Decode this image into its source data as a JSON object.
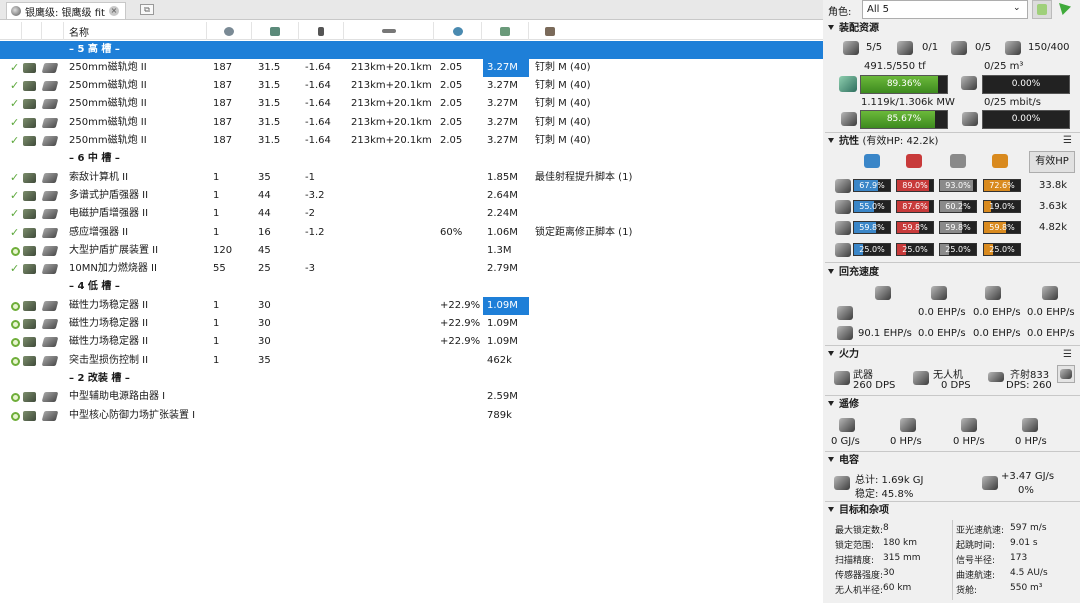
{
  "tab": {
    "title": "银鹰级: 银鹰级 fit",
    "close": "×",
    "new": "⧉"
  },
  "columns": {
    "name": "名称"
  },
  "colors": {
    "rack_bg": "#1e7fd8",
    "em": "#3a86c8",
    "thermal": "#c83a3a",
    "kinetic": "#8a8a8a",
    "explosive": "#d98a1e",
    "cap_green": "#5aa82e"
  },
  "rows": [
    {
      "kind": "rack",
      "label": "– 5 高 槽 –"
    },
    {
      "kind": "mod",
      "state": "on",
      "name": "250mm磁轨炮 II",
      "c1": "187",
      "c2": "31.5",
      "c3": "-1.64",
      "c4": "213km+20.1km",
      "c5": "2.05",
      "c6": "",
      "price": "3.27M",
      "charge": "钉刺 M (40)",
      "hl": true
    },
    {
      "kind": "mod",
      "state": "on",
      "name": "250mm磁轨炮 II",
      "c1": "187",
      "c2": "31.5",
      "c3": "-1.64",
      "c4": "213km+20.1km",
      "c5": "2.05",
      "c6": "",
      "price": "3.27M",
      "charge": "钉刺 M (40)"
    },
    {
      "kind": "mod",
      "state": "on",
      "name": "250mm磁轨炮 II",
      "c1": "187",
      "c2": "31.5",
      "c3": "-1.64",
      "c4": "213km+20.1km",
      "c5": "2.05",
      "c6": "",
      "price": "3.27M",
      "charge": "钉刺 M (40)"
    },
    {
      "kind": "mod",
      "state": "on",
      "name": "250mm磁轨炮 II",
      "c1": "187",
      "c2": "31.5",
      "c3": "-1.64",
      "c4": "213km+20.1km",
      "c5": "2.05",
      "c6": "",
      "price": "3.27M",
      "charge": "钉刺 M (40)"
    },
    {
      "kind": "mod",
      "state": "on",
      "name": "250mm磁轨炮 II",
      "c1": "187",
      "c2": "31.5",
      "c3": "-1.64",
      "c4": "213km+20.1km",
      "c5": "2.05",
      "c6": "",
      "price": "3.27M",
      "charge": "钉刺 M (40)"
    },
    {
      "kind": "sub",
      "label": "– 6 中 槽 –"
    },
    {
      "kind": "mod",
      "state": "on",
      "name": "索敌计算机 II",
      "c1": "1",
      "c2": "35",
      "c3": "-1",
      "c4": "",
      "c5": "",
      "c6": "",
      "price": "1.85M",
      "charge": "最佳射程提升脚本 (1)"
    },
    {
      "kind": "mod",
      "state": "on",
      "name": "多谱式护盾强器 II",
      "c1": "1",
      "c2": "44",
      "c3": "-3.2",
      "c4": "",
      "c5": "",
      "c6": "",
      "price": "2.64M",
      "charge": ""
    },
    {
      "kind": "mod",
      "state": "on",
      "name": "电磁护盾增强器 II",
      "c1": "1",
      "c2": "44",
      "c3": "-2",
      "c4": "",
      "c5": "",
      "c6": "",
      "price": "2.24M",
      "charge": ""
    },
    {
      "kind": "mod",
      "state": "on",
      "name": "感应增强器 II",
      "c1": "1",
      "c2": "16",
      "c3": "-1.2",
      "c4": "",
      "c5": "",
      "c6": "60%",
      "price": "1.06M",
      "charge": "锁定距离修正脚本 (1)"
    },
    {
      "kind": "mod",
      "state": "off",
      "name": "大型护盾扩展装置 II",
      "c1": "120",
      "c2": "45",
      "c3": "",
      "c4": "",
      "c5": "",
      "c6": "",
      "price": "1.3M",
      "charge": ""
    },
    {
      "kind": "mod",
      "state": "on",
      "name": "10MN加力燃烧器 II",
      "c1": "55",
      "c2": "25",
      "c3": "-3",
      "c4": "",
      "c5": "",
      "c6": "",
      "price": "2.79M",
      "charge": ""
    },
    {
      "kind": "sub",
      "label": "– 4 低 槽 –"
    },
    {
      "kind": "mod",
      "state": "off",
      "name": "磁性力场稳定器 II",
      "c1": "1",
      "c2": "30",
      "c3": "",
      "c4": "",
      "c5": "",
      "c6": "+22.9%",
      "price": "1.09M",
      "charge": "",
      "hl": true
    },
    {
      "kind": "mod",
      "state": "off",
      "name": "磁性力场稳定器 II",
      "c1": "1",
      "c2": "30",
      "c3": "",
      "c4": "",
      "c5": "",
      "c6": "+22.9%",
      "price": "1.09M",
      "charge": ""
    },
    {
      "kind": "mod",
      "state": "off",
      "name": "磁性力场稳定器 II",
      "c1": "1",
      "c2": "30",
      "c3": "",
      "c4": "",
      "c5": "",
      "c6": "+22.9%",
      "price": "1.09M",
      "charge": ""
    },
    {
      "kind": "mod",
      "state": "off",
      "name": "突击型损伤控制 II",
      "c1": "1",
      "c2": "35",
      "c3": "",
      "c4": "",
      "c5": "",
      "c6": "",
      "price": "462k",
      "charge": ""
    },
    {
      "kind": "sub",
      "label": "– 2 改装 槽 –"
    },
    {
      "kind": "mod",
      "state": "off",
      "name": "中型辅助电源路由器 I",
      "c1": "",
      "c2": "",
      "c3": "",
      "c4": "",
      "c5": "",
      "c6": "",
      "price": "2.59M",
      "charge": ""
    },
    {
      "kind": "mod",
      "state": "off",
      "name": "中型核心防御力场扩张装置 I",
      "c1": "",
      "c2": "",
      "c3": "",
      "c4": "",
      "c5": "",
      "c6": "",
      "price": "789k",
      "charge": ""
    }
  ],
  "role": {
    "label": "角色:",
    "value": "All 5"
  },
  "fitting": {
    "title": "装配资源",
    "slots": [
      "5/5",
      "0/1",
      "0/5",
      "150/400"
    ],
    "cpu_text": "491.5/550 tf",
    "cpu_pct": "89.36%",
    "cpu_fill": 0.8936,
    "power_text": "1.119k/1.306k MW",
    "power_pct": "85.67%",
    "power_fill": 0.8567,
    "drone_bay_text": "0/25 m³",
    "drone_bay_pct": "0.00%",
    "drone_bw_text": "0/25 mbit/s",
    "drone_bw_pct": "0.00%"
  },
  "resist": {
    "title": "抗性",
    "ehp_label": "(有效HP: 42.2k)",
    "button": "有效HP",
    "rows": [
      {
        "vals": [
          "67.9%",
          "89.0%",
          "93.0%",
          "72.6%"
        ],
        "fills": [
          0.679,
          0.89,
          0.93,
          0.726
        ],
        "hp": "33.8k"
      },
      {
        "vals": [
          "55.0%",
          "87.6%",
          "60.2%",
          "19.0%"
        ],
        "fills": [
          0.55,
          0.876,
          0.602,
          0.19
        ],
        "hp": "3.63k"
      },
      {
        "vals": [
          "59.8%",
          "59.8%",
          "59.8%",
          "59.8%"
        ],
        "fills": [
          0.598,
          0.598,
          0.598,
          0.598
        ],
        "hp": "4.82k"
      },
      {
        "vals": [
          "25.0%",
          "25.0%",
          "25.0%",
          "25.0%"
        ],
        "fills": [
          0.25,
          0.25,
          0.25,
          0.25
        ],
        "hp": ""
      }
    ]
  },
  "recharge": {
    "title": "回充速度",
    "row1": [
      "",
      "0.0 EHP/s",
      "0.0 EHP/s",
      "0.0 EHP/s"
    ],
    "row2": [
      "90.1 EHP/s",
      "0.0 EHP/s",
      "0.0 EHP/s",
      "0.0 EHP/s"
    ]
  },
  "firepower": {
    "title": "火力",
    "weapon_label": "武器",
    "weapon_dps": "260 DPS",
    "drone_label": "无人机",
    "drone_dps": "0 DPS",
    "volley_label": "齐射833",
    "volley_dps": "DPS: 260"
  },
  "remote": {
    "title": "遥修",
    "vals": [
      "0 GJ/s",
      "0 HP/s",
      "0 HP/s",
      "0 HP/s"
    ]
  },
  "capacitor": {
    "title": "电容",
    "total": "总计: 1.69k GJ",
    "stable": "稳定: 45.8%",
    "rate": "+3.47 GJ/s",
    "rate_pct": "0%"
  },
  "targeting": {
    "title": "目标和杂项",
    "left": [
      {
        "k": "最大锁定数:",
        "v": "8"
      },
      {
        "k": "锁定范围:",
        "v": "180 km"
      },
      {
        "k": "扫描精度:",
        "v": "315 mm"
      },
      {
        "k": "传感器强度:",
        "v": "30"
      },
      {
        "k": "无人机半径:",
        "v": "60 km"
      }
    ],
    "right": [
      {
        "k": "亚光速航速:",
        "v": "597 m/s"
      },
      {
        "k": "起跳时间:",
        "v": "9.01 s"
      },
      {
        "k": "信号半径:",
        "v": "173"
      },
      {
        "k": "曲速航速:",
        "v": "4.5 AU/s"
      },
      {
        "k": "货舱:",
        "v": "550 m³"
      }
    ]
  }
}
